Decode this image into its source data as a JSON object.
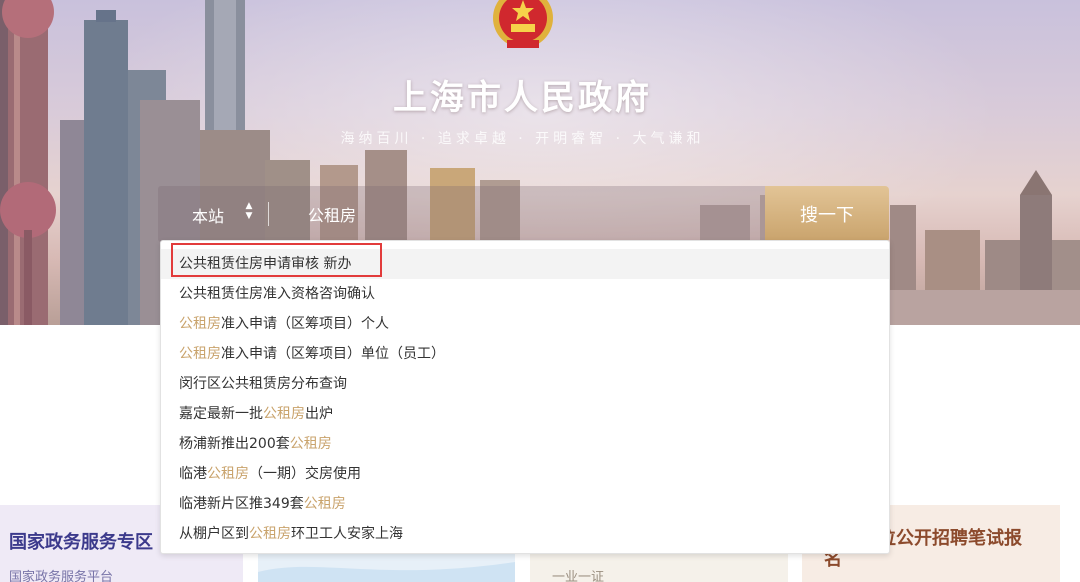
{
  "header": {
    "title": "上海市人民政府",
    "slogan": "海纳百川 · 追求卓越 · 开明睿智 · 大气谦和"
  },
  "search": {
    "scope_label": "本站",
    "query": "公租房",
    "button_label": "搜一下"
  },
  "suggestions": [
    {
      "segments": [
        {
          "text": "公共租赁住房申请审核 新办",
          "hl": false
        }
      ]
    },
    {
      "segments": [
        {
          "text": "公共租赁住房准入资格咨询确认",
          "hl": false
        }
      ]
    },
    {
      "segments": [
        {
          "text": "公租房",
          "hl": true
        },
        {
          "text": "准入申请（区筹项目）个人",
          "hl": false
        }
      ]
    },
    {
      "segments": [
        {
          "text": "公租房",
          "hl": true
        },
        {
          "text": "准入申请（区筹项目）单位（员工）",
          "hl": false
        }
      ]
    },
    {
      "segments": [
        {
          "text": "闵行区公共租赁房分布查询",
          "hl": false
        }
      ]
    },
    {
      "segments": [
        {
          "text": "嘉定最新一批",
          "hl": false
        },
        {
          "text": "公租房",
          "hl": true
        },
        {
          "text": "出炉",
          "hl": false
        }
      ]
    },
    {
      "segments": [
        {
          "text": "杨浦新推出200套",
          "hl": false
        },
        {
          "text": "公租房",
          "hl": true
        }
      ]
    },
    {
      "segments": [
        {
          "text": "临港",
          "hl": false
        },
        {
          "text": "公租房",
          "hl": true
        },
        {
          "text": "（一期）交房使用",
          "hl": false
        }
      ]
    },
    {
      "segments": [
        {
          "text": "临港新片区推349套",
          "hl": false
        },
        {
          "text": "公租房",
          "hl": true
        }
      ]
    },
    {
      "segments": [
        {
          "text": "从棚户区到",
          "hl": false
        },
        {
          "text": "公租房",
          "hl": true
        },
        {
          "text": "环卫工人安家上海",
          "hl": false
        }
      ]
    }
  ],
  "cards": {
    "card1": {
      "title": "国家政务服务专区",
      "subtitle": "国家政务服务平台"
    },
    "card3": {
      "subtitle": "一业一证"
    },
    "card4": {
      "title": "事业单位公开招聘笔试报名"
    }
  },
  "colors": {
    "accent_gold": "#c9a36c",
    "highlight_red": "#e23b3b",
    "card_title_blue": "#3c3a8c"
  },
  "icons": {
    "emblem": "national-emblem-icon",
    "scope_toggle": "updown-arrows-icon"
  }
}
